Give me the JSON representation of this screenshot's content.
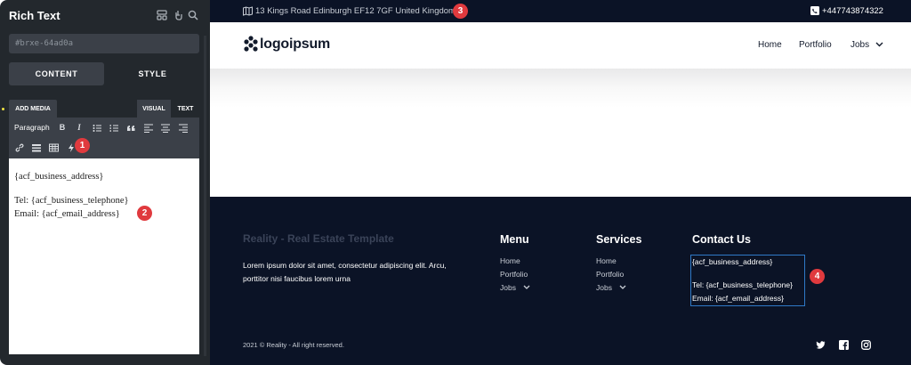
{
  "panel": {
    "title": "Rich Text",
    "element_id": "#brxe-64ad0a",
    "tabs": [
      "CONTENT",
      "STYLE"
    ],
    "add_media": "ADD MEDIA",
    "editor_tabs": [
      "VISUAL",
      "TEXT"
    ],
    "format_select": "Paragraph",
    "toolbar_bold": "B",
    "toolbar_italic": "I",
    "editor_lines": [
      "{acf_business_address}",
      "Tel: {acf_business_telephone}",
      "Email: {acf_email_address}"
    ]
  },
  "badges": [
    "1",
    "2",
    "3",
    "4"
  ],
  "preview": {
    "topbar": {
      "address": "13 Kings Road Edinburgh EF12 7GF United Kingdom",
      "phone": "+447743874322"
    },
    "logo": "logoipsum",
    "nav": [
      "Home",
      "Portfolio",
      "Jobs"
    ],
    "footer": {
      "brand": "Reality - Real Estate Template",
      "description": "Lorem ipsum dolor sit amet, consectetur adipiscing elit. Arcu, porttitor nisi faucibus lorem urna",
      "menu_heading": "Menu",
      "menu_links": [
        "Home",
        "Portfolio",
        "Jobs"
      ],
      "services_heading": "Services",
      "services_links": [
        "Home",
        "Portfolio",
        "Jobs"
      ],
      "contact_heading": "Contact Us",
      "contact_lines": [
        "{acf_business_address}",
        "Tel: {acf_business_telephone}",
        "Email: {acf_email_address}"
      ],
      "copyright": "2021 © Reality - All right reserved."
    }
  },
  "colors": {
    "panel_bg": "#23282d",
    "panel_input": "#3b4048",
    "footer_bg": "#0b1326",
    "badge": "#e03a3e",
    "highlight_border": "#2f79c7"
  },
  "icons": [
    "template-icon",
    "help-icon",
    "search-icon",
    "map-icon",
    "phone-icon",
    "link-icon",
    "horizontal-rule-icon",
    "table-icon",
    "dynamic-data-icon",
    "twitter-icon",
    "facebook-icon",
    "instagram-icon"
  ]
}
